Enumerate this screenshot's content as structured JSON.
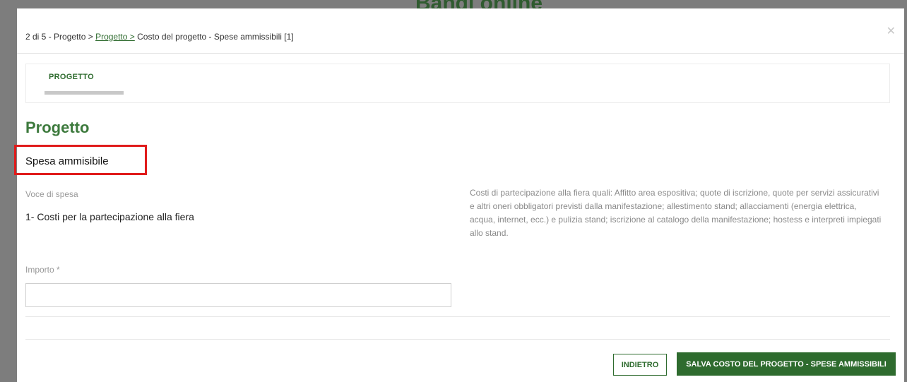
{
  "background_title": "Bandi online",
  "breadcrumb": {
    "step": "2 di 5 - Progetto >",
    "link": "Progetto >",
    "current": "Costo del progetto - Spese ammissibili [1]"
  },
  "close_icon": "close-icon",
  "tabs": [
    {
      "label": "PROGETTO"
    }
  ],
  "section_title": "Progetto",
  "subtitle": "Spesa ammisibile",
  "voce": {
    "label": "Voce di spesa",
    "value": "1- Costi per la partecipazione alla fiera"
  },
  "description": "Costi di partecipazione alla fiera quali: Affitto area espositiva; quote di iscrizione, quote per servizi assicurativi e altri oneri obbligatori previsti dalla manifestazione; allestimento stand; allacciamenti (energia elettrica, acqua, internet, ecc.) e pulizia stand; iscrizione al catalogo della manifestazione; hostess e interpreti impiegati allo stand.",
  "importo": {
    "label": "Importo *",
    "value": "",
    "placeholder": ""
  },
  "buttons": {
    "back": "INDIETRO",
    "save": "SALVA COSTO DEL PROGETTO - SPESE AMMISSIBILI"
  },
  "colors": {
    "accent": "#2e6b2e",
    "highlight": "#e01b1b"
  }
}
